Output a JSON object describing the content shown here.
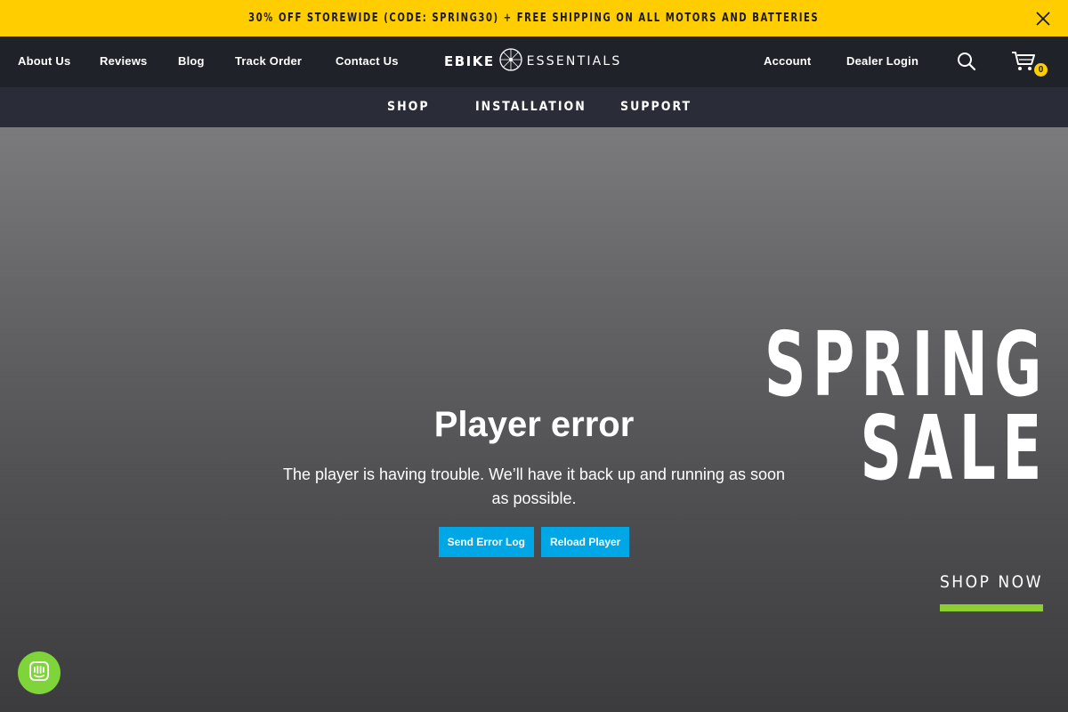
{
  "announcement": {
    "text": "30% OFF STOREWIDE (CODE: SPRING30) + FREE SHIPPING ON ALL MOTORS AND BATTERIES",
    "close_icon": "close-icon",
    "background": "#ffcd00"
  },
  "header": {
    "nav": [
      {
        "label": "About Us"
      },
      {
        "label": "Reviews"
      },
      {
        "label": "Blog"
      },
      {
        "label": "Track Order"
      },
      {
        "label": "Contact Us"
      }
    ],
    "logo": {
      "word1": "EBIKE",
      "word2": "ESSENTIALS",
      "icon": "bicycle-wheel-icon"
    },
    "account_label": "Account",
    "dealer_login_label": "Dealer Login",
    "search_icon": "search-icon",
    "cart_icon": "cart-icon",
    "cart_count": "0"
  },
  "subnav": {
    "items": [
      {
        "label": "SHOP"
      },
      {
        "label": "INSTALLATION"
      },
      {
        "label": "SUPPORT"
      }
    ]
  },
  "hero": {
    "title_line1": "SPRING",
    "title_line2": "SALE",
    "cta_label": "SHOP NOW",
    "cta_underline_color": "#8ccf2e"
  },
  "player_error": {
    "title": "Player error",
    "message": "The player is having trouble. We’ll have it back up and running as soon as possible.",
    "send_log_label": "Send Error Log",
    "reload_label": "Reload Player",
    "button_color": "#00a7e6"
  },
  "chat": {
    "icon": "chat-icon",
    "color": "#7fd43a"
  }
}
